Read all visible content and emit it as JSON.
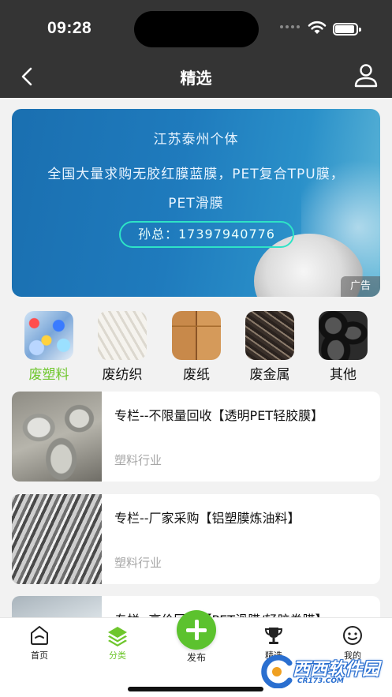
{
  "status_bar": {
    "time": "09:28"
  },
  "nav": {
    "title": "精选"
  },
  "banner": {
    "line1": "江苏泰州个体",
    "line2": "全国大量求购无胶红膜蓝膜，PET复合TPU膜，",
    "line3": "PET滑膜",
    "phone": "孙总：17397940776",
    "ad_tag": "广告"
  },
  "categories": [
    {
      "label": "废塑料",
      "active": true
    },
    {
      "label": "废纺织"
    },
    {
      "label": "废纸"
    },
    {
      "label": "废金属"
    },
    {
      "label": "其他"
    }
  ],
  "list": [
    {
      "title": "专栏--不限量回收【透明PET轻胶膜】",
      "sub": "塑料行业"
    },
    {
      "title": "专栏--厂家采购【铝塑膜炼油料】",
      "sub": "塑料行业"
    },
    {
      "title": "专栏--高价回收【PET滑膜/轻胶卷膜】",
      "sub": ""
    }
  ],
  "tabbar": {
    "home": "首页",
    "category": "分类",
    "publish": "发布",
    "featured": "精选",
    "mine": "我的"
  },
  "watermark": {
    "text": "西西软件园",
    "url": "CR173.COM"
  },
  "colors": {
    "accent": "#6ec62c",
    "publish": "#5cc22e",
    "header": "#343434"
  }
}
